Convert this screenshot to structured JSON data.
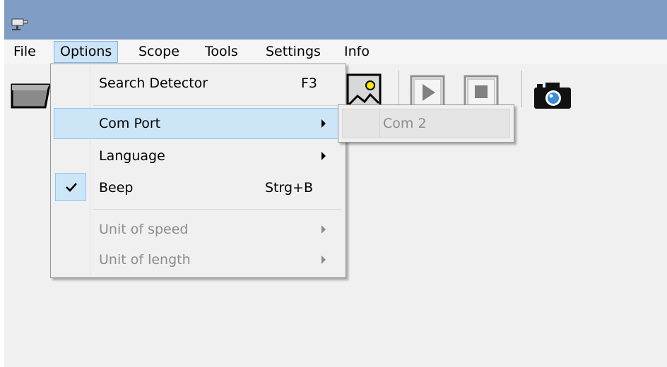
{
  "menubar": {
    "items": [
      {
        "label": "File"
      },
      {
        "label": "Options"
      },
      {
        "label": "Scope"
      },
      {
        "label": "Tools"
      },
      {
        "label": "Settings"
      },
      {
        "label": "Info"
      }
    ],
    "active": "Options"
  },
  "options_menu": {
    "search_detector": {
      "label": "Search Detector",
      "shortcut": "F3"
    },
    "com_port": {
      "label": "Com Port",
      "has_submenu": true,
      "highlighted": true
    },
    "language": {
      "label": "Language",
      "has_submenu": true
    },
    "beep": {
      "label": "Beep",
      "shortcut": "Strg+B",
      "checked": true
    },
    "unit_of_speed": {
      "label": "Unit of speed",
      "has_submenu": true,
      "disabled": true
    },
    "unit_of_length": {
      "label": "Unit of length",
      "has_submenu": true,
      "disabled": true
    }
  },
  "com_port_submenu": {
    "items": [
      {
        "label": "Com 2",
        "disabled": true
      }
    ]
  },
  "toolbar": {
    "icons": [
      "folder-open-icon",
      "image-icon",
      "play-icon",
      "stop-icon",
      "camera-icon"
    ]
  },
  "colors": {
    "title_bar": "#7f9dc5",
    "highlight": "#cde6f7",
    "highlight_border": "#90c8f6",
    "disabled_text": "#8c8c8c"
  }
}
